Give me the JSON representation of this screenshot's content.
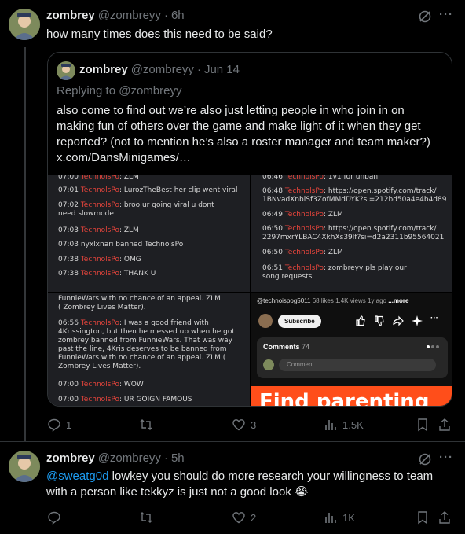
{
  "post1": {
    "name": "zombrey",
    "handle": "@zombreyy",
    "sep": "·",
    "time": "6h",
    "text": "how many times does this need to be said?",
    "more": "···"
  },
  "quote": {
    "name": "zombrey",
    "handle": "@zombreyy",
    "sep": "·",
    "time": "Jun 14",
    "replying": "Replying to @zombreyy",
    "text": "also come to find out we’re also just letting people in who join in on making fun of others over the game and make light of it when they get reported? (not to mention he’s also a roster manager and team maker?) x.com/DansMinigames/…"
  },
  "img1": [
    {
      "t": "07:00",
      "u": "TechnolsPo",
      "m": ": ZLM"
    },
    {
      "t": "07:01",
      "u": "TechnolsPo",
      "m": ": LurozTheBest her clip went viral"
    },
    {
      "t": "07:02",
      "u": "TechnolsPo",
      "m": ": broo ur going viral u dont"
    },
    {
      "t": "",
      "u": "",
      "m": "need slowmode"
    },
    {
      "t": "07:03",
      "u": "TechnolsPo",
      "m": ": ZLM"
    },
    {
      "t": "07:03",
      "u": "",
      "m": "nyxlxnari banned TechnolsPo"
    },
    {
      "t": "07:38",
      "u": "TechnolsPo",
      "m": ": OMG"
    },
    {
      "t": "07:38",
      "u": "TechnolsPo",
      "m": ": THANK U"
    }
  ],
  "img2": [
    {
      "t": "06:46",
      "u": "TechnolsPo",
      "m": ": 1v1 for unban"
    },
    {
      "t": "06:48",
      "u": "TechnolsPo",
      "m": ": https://open.spotify.com/track/"
    },
    {
      "t": "",
      "u": "",
      "m": "1BNvadXnbiSf3ZofMMdDYK?si=212bd50a4e4b4d89"
    },
    {
      "t": "06:49",
      "u": "TechnolsPo",
      "m": ": ZLM"
    },
    {
      "t": "06:50",
      "u": "TechnolsPo",
      "m": ": https://open.spotify.com/track/"
    },
    {
      "t": "",
      "u": "",
      "m": "2297mxrYLBAC4XkhXs39lf?si=d2a2311b95564021"
    },
    {
      "t": "06:50",
      "u": "TechnolsPo",
      "m": ": ZLM"
    },
    {
      "t": "06:51",
      "u": "TechnolsPo",
      "m": ": zombreyy pls play our"
    },
    {
      "t": "",
      "u": "",
      "m": "song requests"
    }
  ],
  "img3": {
    "l1": "FunnieWars with no chance of an appeal. ZLM",
    "l2": "( Zombrey Lives Matter).",
    "t1": "06:56",
    "u1": "TechnolsPo",
    "m1": ": I was a good friend with",
    "p1": "4Krissington, but then he messed up when he got zombrey banned from FunnieWars. That was way past the line, 4Kris deserves to be banned from FunnieWars with no chance of an appeal. ZLM ( Zombrey Lives Matter).",
    "t2": "07:00",
    "u2": "TechnolsPo",
    "m2": ": WOW",
    "t3": "07:00",
    "u3": "TechnolsPo",
    "m3": ": UR GOIGN FAMOUS"
  },
  "img4": {
    "channel": "@technoispog5011",
    "likes": "68 likes",
    "views": "1.4K views",
    "ago": "1y ago",
    "more": "...more",
    "subscribe": "Subscribe",
    "comments_label": "Comments",
    "comments_count": "74",
    "comment_placeholder": "Comment...",
    "banner": "Find parenting"
  },
  "actions1": {
    "replies": "1",
    "reposts": "",
    "likes": "3",
    "views": "1.5K"
  },
  "post2": {
    "name": "zombrey",
    "handle": "@zombreyy",
    "sep": "·",
    "time": "5h",
    "mention": "@sweatg0d",
    "text": " lowkey you should do more research your willingness to team with a person like tekkyz is just not a good look 😭",
    "more": "···"
  },
  "actions2": {
    "replies": "",
    "reposts": "",
    "likes": "2",
    "views": "1K"
  },
  "colors": {
    "accent": "#1d9bf0",
    "muted": "#71767b",
    "techno_red": "#e8453c"
  }
}
